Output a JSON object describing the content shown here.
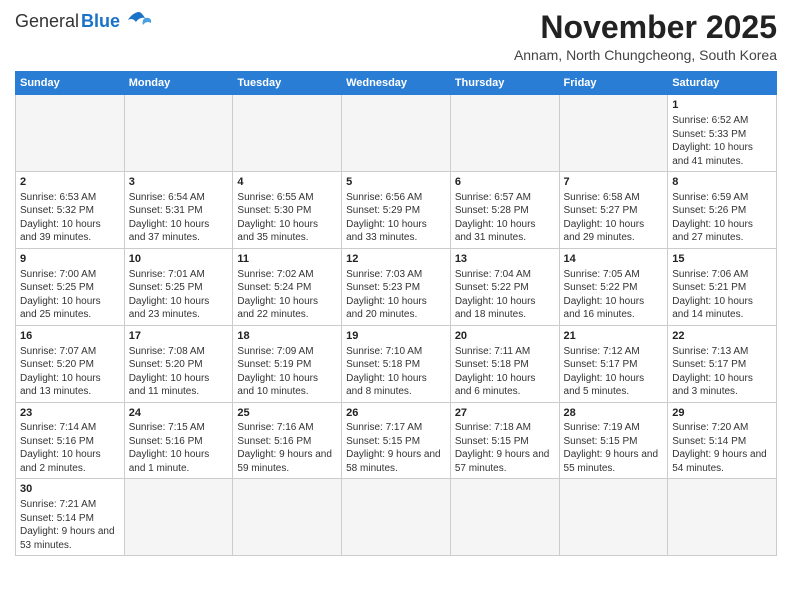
{
  "header": {
    "logo_general": "General",
    "logo_blue": "Blue",
    "month_title": "November 2025",
    "subtitle": "Annam, North Chungcheong, South Korea"
  },
  "weekdays": [
    "Sunday",
    "Monday",
    "Tuesday",
    "Wednesday",
    "Thursday",
    "Friday",
    "Saturday"
  ],
  "days": [
    {
      "num": "",
      "info": ""
    },
    {
      "num": "",
      "info": ""
    },
    {
      "num": "",
      "info": ""
    },
    {
      "num": "",
      "info": ""
    },
    {
      "num": "",
      "info": ""
    },
    {
      "num": "",
      "info": ""
    },
    {
      "num": "1",
      "info": "Sunrise: 6:52 AM\nSunset: 5:33 PM\nDaylight: 10 hours and 41 minutes."
    },
    {
      "num": "2",
      "info": "Sunrise: 6:53 AM\nSunset: 5:32 PM\nDaylight: 10 hours and 39 minutes."
    },
    {
      "num": "3",
      "info": "Sunrise: 6:54 AM\nSunset: 5:31 PM\nDaylight: 10 hours and 37 minutes."
    },
    {
      "num": "4",
      "info": "Sunrise: 6:55 AM\nSunset: 5:30 PM\nDaylight: 10 hours and 35 minutes."
    },
    {
      "num": "5",
      "info": "Sunrise: 6:56 AM\nSunset: 5:29 PM\nDaylight: 10 hours and 33 minutes."
    },
    {
      "num": "6",
      "info": "Sunrise: 6:57 AM\nSunset: 5:28 PM\nDaylight: 10 hours and 31 minutes."
    },
    {
      "num": "7",
      "info": "Sunrise: 6:58 AM\nSunset: 5:27 PM\nDaylight: 10 hours and 29 minutes."
    },
    {
      "num": "8",
      "info": "Sunrise: 6:59 AM\nSunset: 5:26 PM\nDaylight: 10 hours and 27 minutes."
    },
    {
      "num": "9",
      "info": "Sunrise: 7:00 AM\nSunset: 5:25 PM\nDaylight: 10 hours and 25 minutes."
    },
    {
      "num": "10",
      "info": "Sunrise: 7:01 AM\nSunset: 5:25 PM\nDaylight: 10 hours and 23 minutes."
    },
    {
      "num": "11",
      "info": "Sunrise: 7:02 AM\nSunset: 5:24 PM\nDaylight: 10 hours and 22 minutes."
    },
    {
      "num": "12",
      "info": "Sunrise: 7:03 AM\nSunset: 5:23 PM\nDaylight: 10 hours and 20 minutes."
    },
    {
      "num": "13",
      "info": "Sunrise: 7:04 AM\nSunset: 5:22 PM\nDaylight: 10 hours and 18 minutes."
    },
    {
      "num": "14",
      "info": "Sunrise: 7:05 AM\nSunset: 5:22 PM\nDaylight: 10 hours and 16 minutes."
    },
    {
      "num": "15",
      "info": "Sunrise: 7:06 AM\nSunset: 5:21 PM\nDaylight: 10 hours and 14 minutes."
    },
    {
      "num": "16",
      "info": "Sunrise: 7:07 AM\nSunset: 5:20 PM\nDaylight: 10 hours and 13 minutes."
    },
    {
      "num": "17",
      "info": "Sunrise: 7:08 AM\nSunset: 5:20 PM\nDaylight: 10 hours and 11 minutes."
    },
    {
      "num": "18",
      "info": "Sunrise: 7:09 AM\nSunset: 5:19 PM\nDaylight: 10 hours and 10 minutes."
    },
    {
      "num": "19",
      "info": "Sunrise: 7:10 AM\nSunset: 5:18 PM\nDaylight: 10 hours and 8 minutes."
    },
    {
      "num": "20",
      "info": "Sunrise: 7:11 AM\nSunset: 5:18 PM\nDaylight: 10 hours and 6 minutes."
    },
    {
      "num": "21",
      "info": "Sunrise: 7:12 AM\nSunset: 5:17 PM\nDaylight: 10 hours and 5 minutes."
    },
    {
      "num": "22",
      "info": "Sunrise: 7:13 AM\nSunset: 5:17 PM\nDaylight: 10 hours and 3 minutes."
    },
    {
      "num": "23",
      "info": "Sunrise: 7:14 AM\nSunset: 5:16 PM\nDaylight: 10 hours and 2 minutes."
    },
    {
      "num": "24",
      "info": "Sunrise: 7:15 AM\nSunset: 5:16 PM\nDaylight: 10 hours and 1 minute."
    },
    {
      "num": "25",
      "info": "Sunrise: 7:16 AM\nSunset: 5:16 PM\nDaylight: 9 hours and 59 minutes."
    },
    {
      "num": "26",
      "info": "Sunrise: 7:17 AM\nSunset: 5:15 PM\nDaylight: 9 hours and 58 minutes."
    },
    {
      "num": "27",
      "info": "Sunrise: 7:18 AM\nSunset: 5:15 PM\nDaylight: 9 hours and 57 minutes."
    },
    {
      "num": "28",
      "info": "Sunrise: 7:19 AM\nSunset: 5:15 PM\nDaylight: 9 hours and 55 minutes."
    },
    {
      "num": "29",
      "info": "Sunrise: 7:20 AM\nSunset: 5:14 PM\nDaylight: 9 hours and 54 minutes."
    },
    {
      "num": "30",
      "info": "Sunrise: 7:21 AM\nSunset: 5:14 PM\nDaylight: 9 hours and 53 minutes."
    },
    {
      "num": "",
      "info": ""
    },
    {
      "num": "",
      "info": ""
    },
    {
      "num": "",
      "info": ""
    },
    {
      "num": "",
      "info": ""
    },
    {
      "num": "",
      "info": ""
    },
    {
      "num": "",
      "info": ""
    }
  ]
}
